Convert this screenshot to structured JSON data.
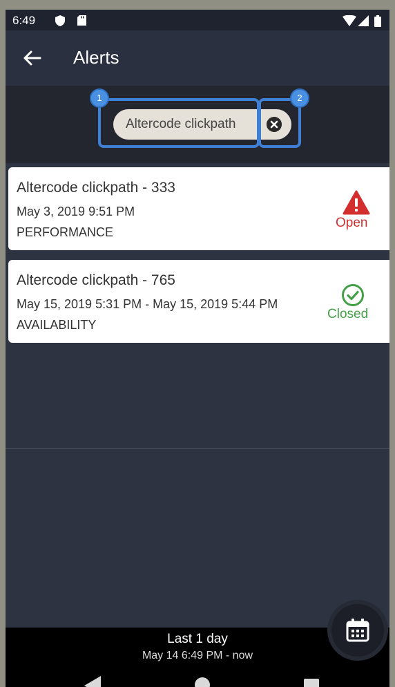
{
  "status_bar": {
    "time": "6:49"
  },
  "app_bar": {
    "title": "Alerts"
  },
  "filter": {
    "chip_label": "Altercode clickpath",
    "annotations": [
      "1",
      "2"
    ]
  },
  "alerts": [
    {
      "title": "Altercode clickpath - 333",
      "date": "May 3, 2019 9:51 PM",
      "type": "PERFORMANCE",
      "status": "Open",
      "status_color": "#d32f2f"
    },
    {
      "title": "Altercode clickpath - 765",
      "date": "May 15, 2019 5:31 PM - May 15, 2019 5:44 PM",
      "type": "AVAILABILITY",
      "status": "Closed",
      "status_color": "#43a047"
    }
  ],
  "time_range": {
    "title": "Last 1 day",
    "subtitle": "May 14 6:49 PM - now"
  }
}
